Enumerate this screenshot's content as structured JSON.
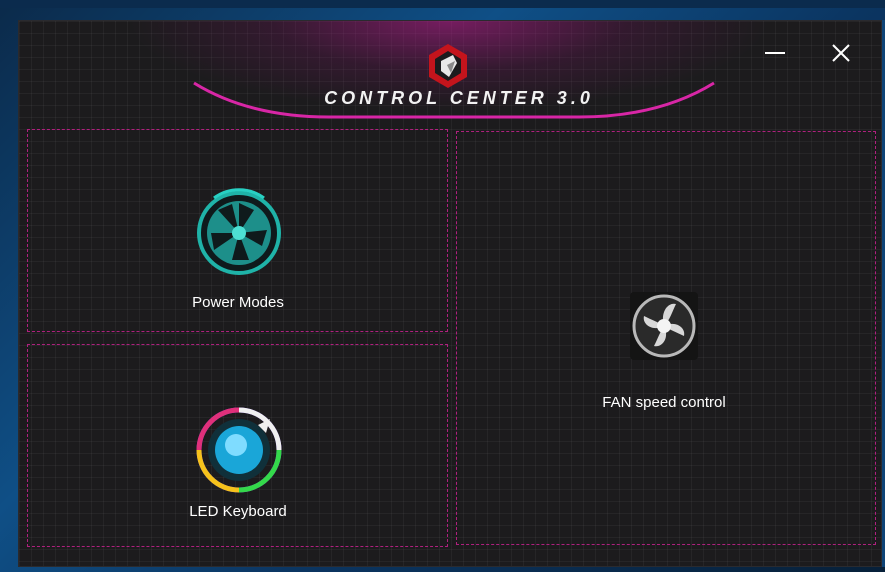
{
  "window": {
    "title": "CONTROL CENTER 3.0",
    "accent_color": "#c0208f",
    "background_color": "#1c1b1d"
  },
  "controls": {
    "minimize_icon": "minimize-icon",
    "close_icon": "close-icon"
  },
  "tiles": {
    "power_modes": {
      "label": "Power Modes",
      "icon": "power-modes-icon"
    },
    "led_keyboard": {
      "label": "LED Keyboard",
      "icon": "led-keyboard-icon"
    },
    "fan_speed": {
      "label": "FAN speed control",
      "icon": "fan-icon"
    }
  }
}
